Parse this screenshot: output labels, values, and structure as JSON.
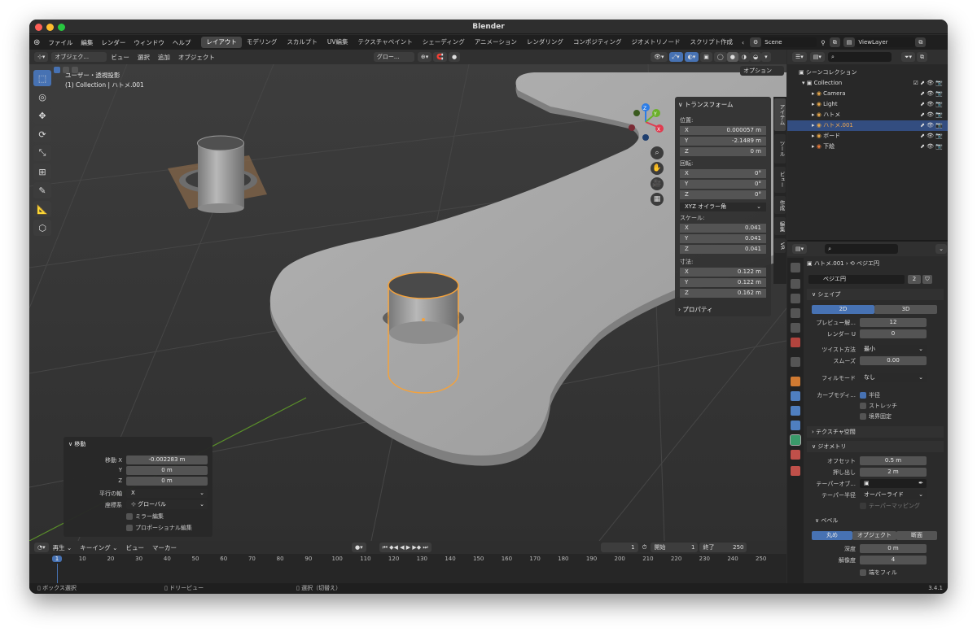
{
  "titlebar": {
    "title": "Blender"
  },
  "menu": {
    "items": [
      "ファイル",
      "編集",
      "レンダー",
      "ウィンドウ",
      "ヘルプ"
    ]
  },
  "workspaces": {
    "tabs": [
      "レイアウト",
      "モデリング",
      "スカルプト",
      "UV編集",
      "テクスチャペイント",
      "シェーディング",
      "アニメーション",
      "レンダリング",
      "コンポジティング",
      "ジオメトリノード",
      "スクリプト作成"
    ],
    "active": "レイアウト",
    "scene": "Scene",
    "view_layer": "ViewLayer"
  },
  "viewport_header": {
    "mode": "オブジェク...",
    "view": "ビュー",
    "select": "選択",
    "add": "追加",
    "object": "オブジェクト",
    "orientation": "グロー...",
    "options": "オプション"
  },
  "viewport": {
    "view_name": "ユーザー・透視投影",
    "collection_info": "(1) Collection | ハトメ.001",
    "axes": {
      "x": "X",
      "y": "Y",
      "z": "Z"
    }
  },
  "npanel": {
    "transform_title": "トランスフォーム",
    "location_label": "位置:",
    "location": [
      {
        "axis": "X",
        "value": "0.000057 m"
      },
      {
        "axis": "Y",
        "value": "-2.1489 m"
      },
      {
        "axis": "Z",
        "value": "0 m"
      }
    ],
    "rotation_label": "回転:",
    "rotation": [
      {
        "axis": "X",
        "value": "0°"
      },
      {
        "axis": "Y",
        "value": "0°"
      },
      {
        "axis": "Z",
        "value": "0°"
      }
    ],
    "rotation_mode": "XYZ オイラー角",
    "scale_label": "スケール:",
    "scale": [
      {
        "axis": "X",
        "value": "0.041"
      },
      {
        "axis": "Y",
        "value": "0.041"
      },
      {
        "axis": "Z",
        "value": "0.041"
      }
    ],
    "dimensions_label": "寸法:",
    "dimensions": [
      {
        "axis": "X",
        "value": "0.122 m"
      },
      {
        "axis": "Y",
        "value": "0.122 m"
      },
      {
        "axis": "Z",
        "value": "0.162 m"
      }
    ],
    "properties_label": "プロパティ",
    "side_tabs": [
      "アイテム",
      "ツール",
      "ビュー",
      "作成",
      "編集",
      "VR"
    ]
  },
  "last_operator": {
    "title": "移動",
    "move_x_label": "移動 X",
    "move_x": "-0.002283 m",
    "y_label": "Y",
    "y": "0 m",
    "z_label": "Z",
    "z": "0 m",
    "axis_label": "平行の軸",
    "axis": "X",
    "orient_label": "座標系",
    "orient": "グローバル",
    "mirror": "ミラー編集",
    "proportional": "プロポーショナル編集"
  },
  "outliner": {
    "root": "シーンコレクション",
    "collection": "Collection",
    "items": [
      {
        "name": "Camera",
        "color": "#e8a84a"
      },
      {
        "name": "Light",
        "color": "#e8a84a"
      },
      {
        "name": "ハトメ",
        "color": "#e8a84a"
      },
      {
        "name": "ハトメ.001",
        "color": "#e8a84a"
      },
      {
        "name": "ボード",
        "color": "#e8a84a"
      },
      {
        "name": "下絵",
        "color": "#e87a3a"
      }
    ],
    "selected": "ハトメ.001"
  },
  "properties": {
    "object_name": "ハトメ.001",
    "data_name": "ベジエ円",
    "data_label": "ベジエ円",
    "users": "2",
    "shape_title": "シェイプ",
    "dim_2d": "2D",
    "dim_3d": "3D",
    "preview_label": "プレビュー解...",
    "preview_value": "12",
    "render_label": "レンダー U",
    "render_value": "0",
    "twist_label": "ツイスト方法",
    "twist_value": "最小",
    "smooth_label": "スムーズ",
    "smooth_value": "0.00",
    "fill_label": "フィルモード",
    "fill_value": "なし",
    "curve_label": "カーブモディ...",
    "radius_cb": "半径",
    "stretch_cb": "ストレッチ",
    "bounds_cb": "境界固定",
    "texspace_title": "テクスチャ空間",
    "geometry_title": "ジオメトリ",
    "offset_label": "オフセット",
    "offset_value": "0.5 m",
    "extrude_label": "押し出し",
    "extrude_value": "2 m",
    "taper_label": "テーパーオブ...",
    "taper_radius_label": "テーパー半径",
    "taper_radius_value": "オーバーライド",
    "taper_mapping": "テーパーマッピング",
    "bevel_title": "ベベル",
    "bevel_round": "丸め",
    "bevel_object": "オブジェクト",
    "bevel_profile": "断面",
    "depth_label": "深度",
    "depth_value": "0 m",
    "resolution_label": "解像度",
    "resolution_value": "4",
    "fill_caps": "端をフィル"
  },
  "timeline": {
    "playback": "再生",
    "keying": "キーイング",
    "view": "ビュー",
    "marker": "マーカー",
    "current_frame": "1",
    "start_label": "開始",
    "start": "1",
    "end_label": "終了",
    "end": "250",
    "ticks": [
      "1",
      "10",
      "20",
      "30",
      "40",
      "50",
      "60",
      "70",
      "80",
      "90",
      "100",
      "110",
      "120",
      "130",
      "140",
      "150",
      "160",
      "170",
      "180",
      "190",
      "200",
      "210",
      "220",
      "230",
      "240",
      "250"
    ]
  },
  "statusbar": {
    "left": "ボックス選択",
    "middle": "ドリービュー",
    "right": "選択（切替え）",
    "version": "3.4.1"
  }
}
